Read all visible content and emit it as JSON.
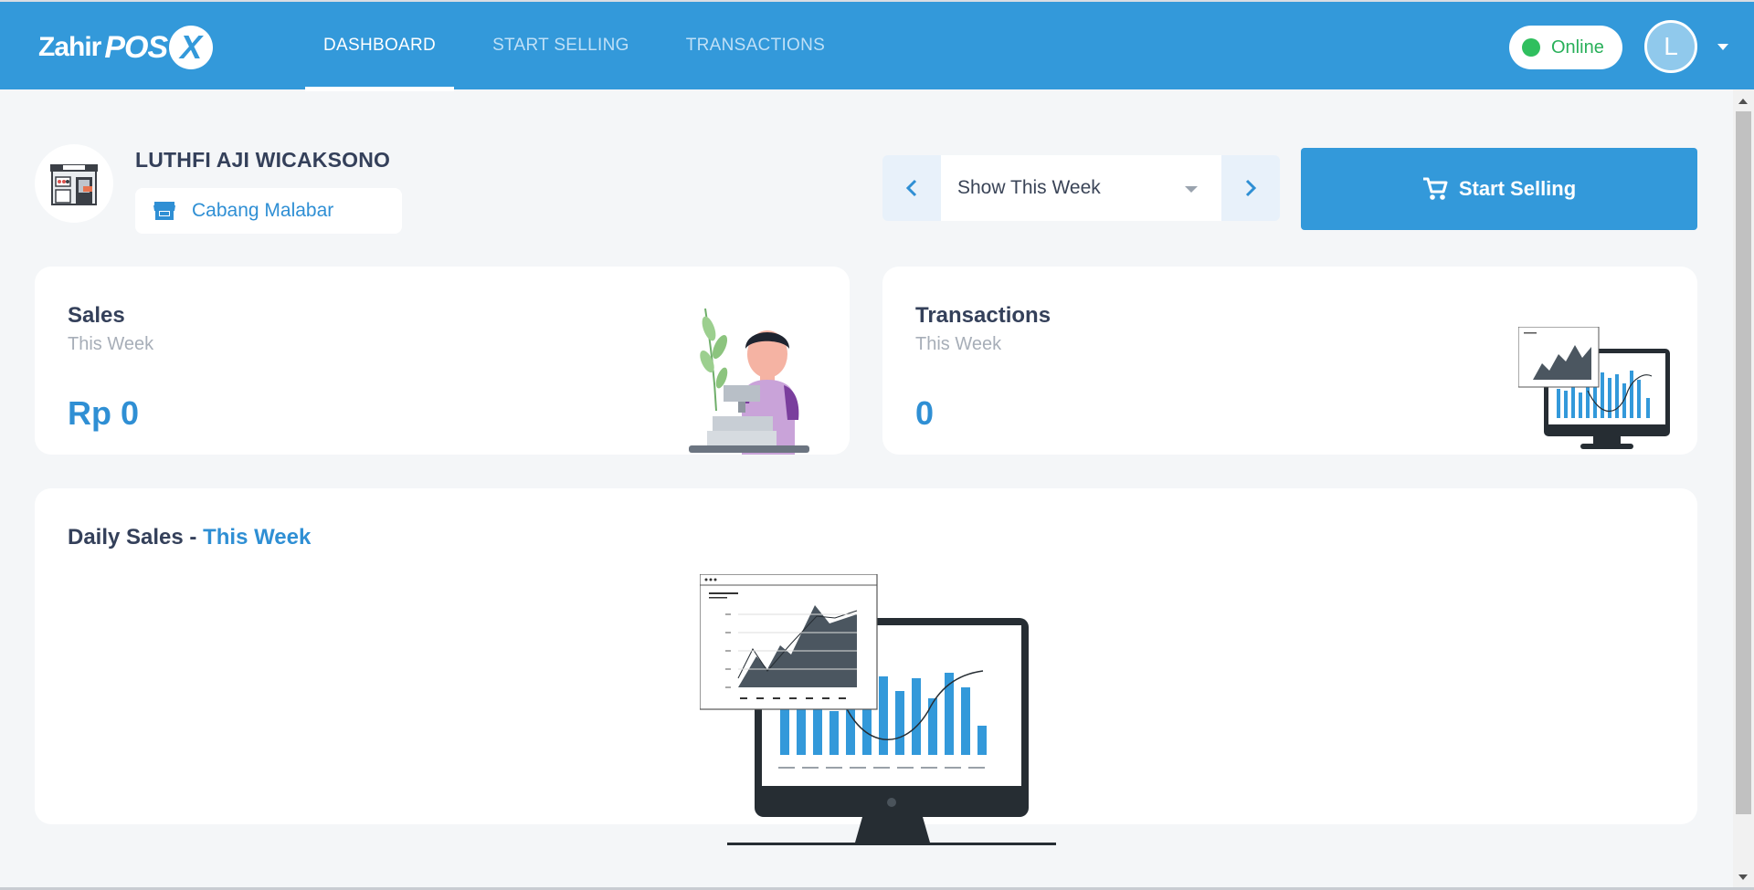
{
  "app": {
    "logo_zahir": "Zahir",
    "logo_pos": "POS",
    "logo_x": "X"
  },
  "nav": {
    "dashboard": "DASHBOARD",
    "start_selling": "START SELLING",
    "transactions": "TRANSACTIONS"
  },
  "status": {
    "label": "Online",
    "color": "#2fbf5e"
  },
  "user": {
    "avatar_initial": "L",
    "name": "LUTHFI AJI WICAKSONO",
    "branch": "Cabang Malabar"
  },
  "period": {
    "selected": "Show This Week"
  },
  "actions": {
    "start_selling": "Start Selling"
  },
  "cards": {
    "sales": {
      "title": "Sales",
      "subtitle": "This Week",
      "value": "Rp 0"
    },
    "transactions": {
      "title": "Transactions",
      "subtitle": "This Week",
      "value": "0"
    }
  },
  "daily": {
    "title_prefix": "Daily Sales - ",
    "title_accent": "This Week"
  },
  "colors": {
    "primary": "#3399da",
    "accent_text": "#2f8fd4",
    "background": "#f4f6f8"
  },
  "icons": {
    "store": "store-icon",
    "cart": "cart-icon",
    "prev": "chevron-left-icon",
    "next": "chevron-right-icon",
    "dropdown": "caret-down-icon"
  }
}
